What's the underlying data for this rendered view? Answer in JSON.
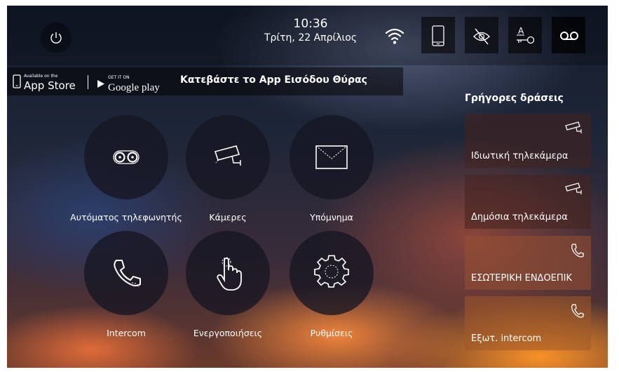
{
  "header": {
    "time": "10:36",
    "date": "Τρίτη, 22 Απρίλιος"
  },
  "app_banner": {
    "appstore_small": "Available on the",
    "appstore_big": "App Store",
    "googleplay_small": "GET IT ON",
    "googleplay_big": "Google play",
    "promo": "Κατεβάστε το App Εισόδου Θύρας"
  },
  "tiles": [
    {
      "label": "Αυτόματος τηλεφωνητής",
      "icon": "voicemail-icon"
    },
    {
      "label": "Κάμερες",
      "icon": "camera-icon"
    },
    {
      "label": "Υπόμνημα",
      "icon": "envelope-icon"
    },
    {
      "label": "Intercom",
      "icon": "phone-icon"
    },
    {
      "label": "Ενεργοποιήσεις",
      "icon": "hand-pointer-icon"
    },
    {
      "label": "Ρυθμίσεις",
      "icon": "gear-icon"
    }
  ],
  "quick_actions": {
    "title": "Γρήγορες δράσεις",
    "items": [
      {
        "label": "Ιδιωτική τηλεκάμερα",
        "icon": "camera-icon"
      },
      {
        "label": "Δημόσια τηλεκάμερα",
        "icon": "camera-icon"
      },
      {
        "label": "ΕΣΩΤΕΡΙΚΗ ΕΝΔΟΕΠΙΚ",
        "icon": "phone-icon"
      },
      {
        "label": "Εξωτ. intercom",
        "icon": "phone-icon"
      }
    ]
  },
  "toolbar_icons": [
    "power-icon",
    "wifi-icon",
    "smartphone-icon",
    "eye-off-icon",
    "key-icon",
    "voicemail-icon"
  ]
}
